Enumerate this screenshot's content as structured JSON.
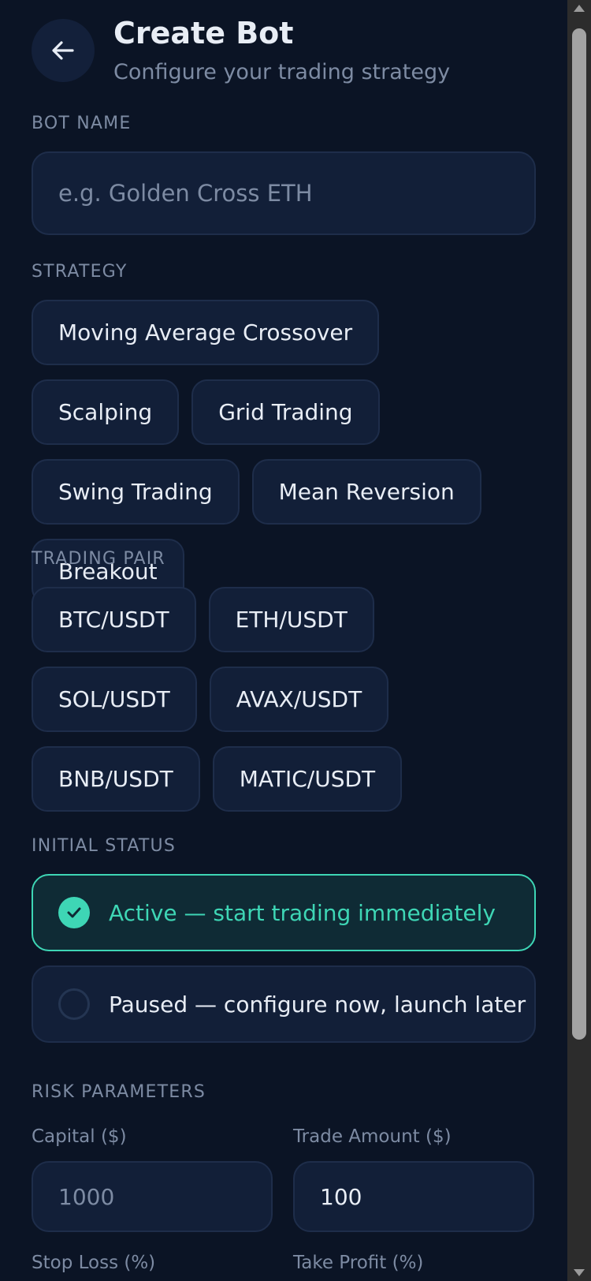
{
  "header": {
    "title": "Create Bot",
    "subtitle": "Configure your trading strategy"
  },
  "bot_name": {
    "label": "BOT NAME",
    "placeholder": "e.g. Golden Cross ETH"
  },
  "strategy": {
    "label": "STRATEGY",
    "options": [
      "Moving Average Crossover",
      "Scalping",
      "Grid Trading",
      "Swing Trading",
      "Mean Reversion",
      "Breakout"
    ]
  },
  "trading_pair": {
    "label": "TRADING PAIR",
    "options": [
      "BTC/USDT",
      "ETH/USDT",
      "SOL/USDT",
      "AVAX/USDT",
      "BNB/USDT",
      "MATIC/USDT"
    ]
  },
  "initial_status": {
    "label": "INITIAL STATUS",
    "active": "Active — start trading immediately",
    "paused": "Paused — configure now, launch later",
    "selected": "active"
  },
  "risk": {
    "label": "RISK PARAMETERS",
    "capital_label": "Capital ($)",
    "capital_value": "1000",
    "trade_amount_label": "Trade Amount ($)",
    "trade_amount_value": "100",
    "stop_loss_label": "Stop Loss (%)",
    "take_profit_label": "Take Profit (%)"
  },
  "colors": {
    "background": "#0b1425",
    "card": "#121f38",
    "accent": "#3ed6b5",
    "muted_text": "#7d8ba3"
  },
  "icons": {
    "back": "arrow-left-icon",
    "check": "check-icon"
  }
}
